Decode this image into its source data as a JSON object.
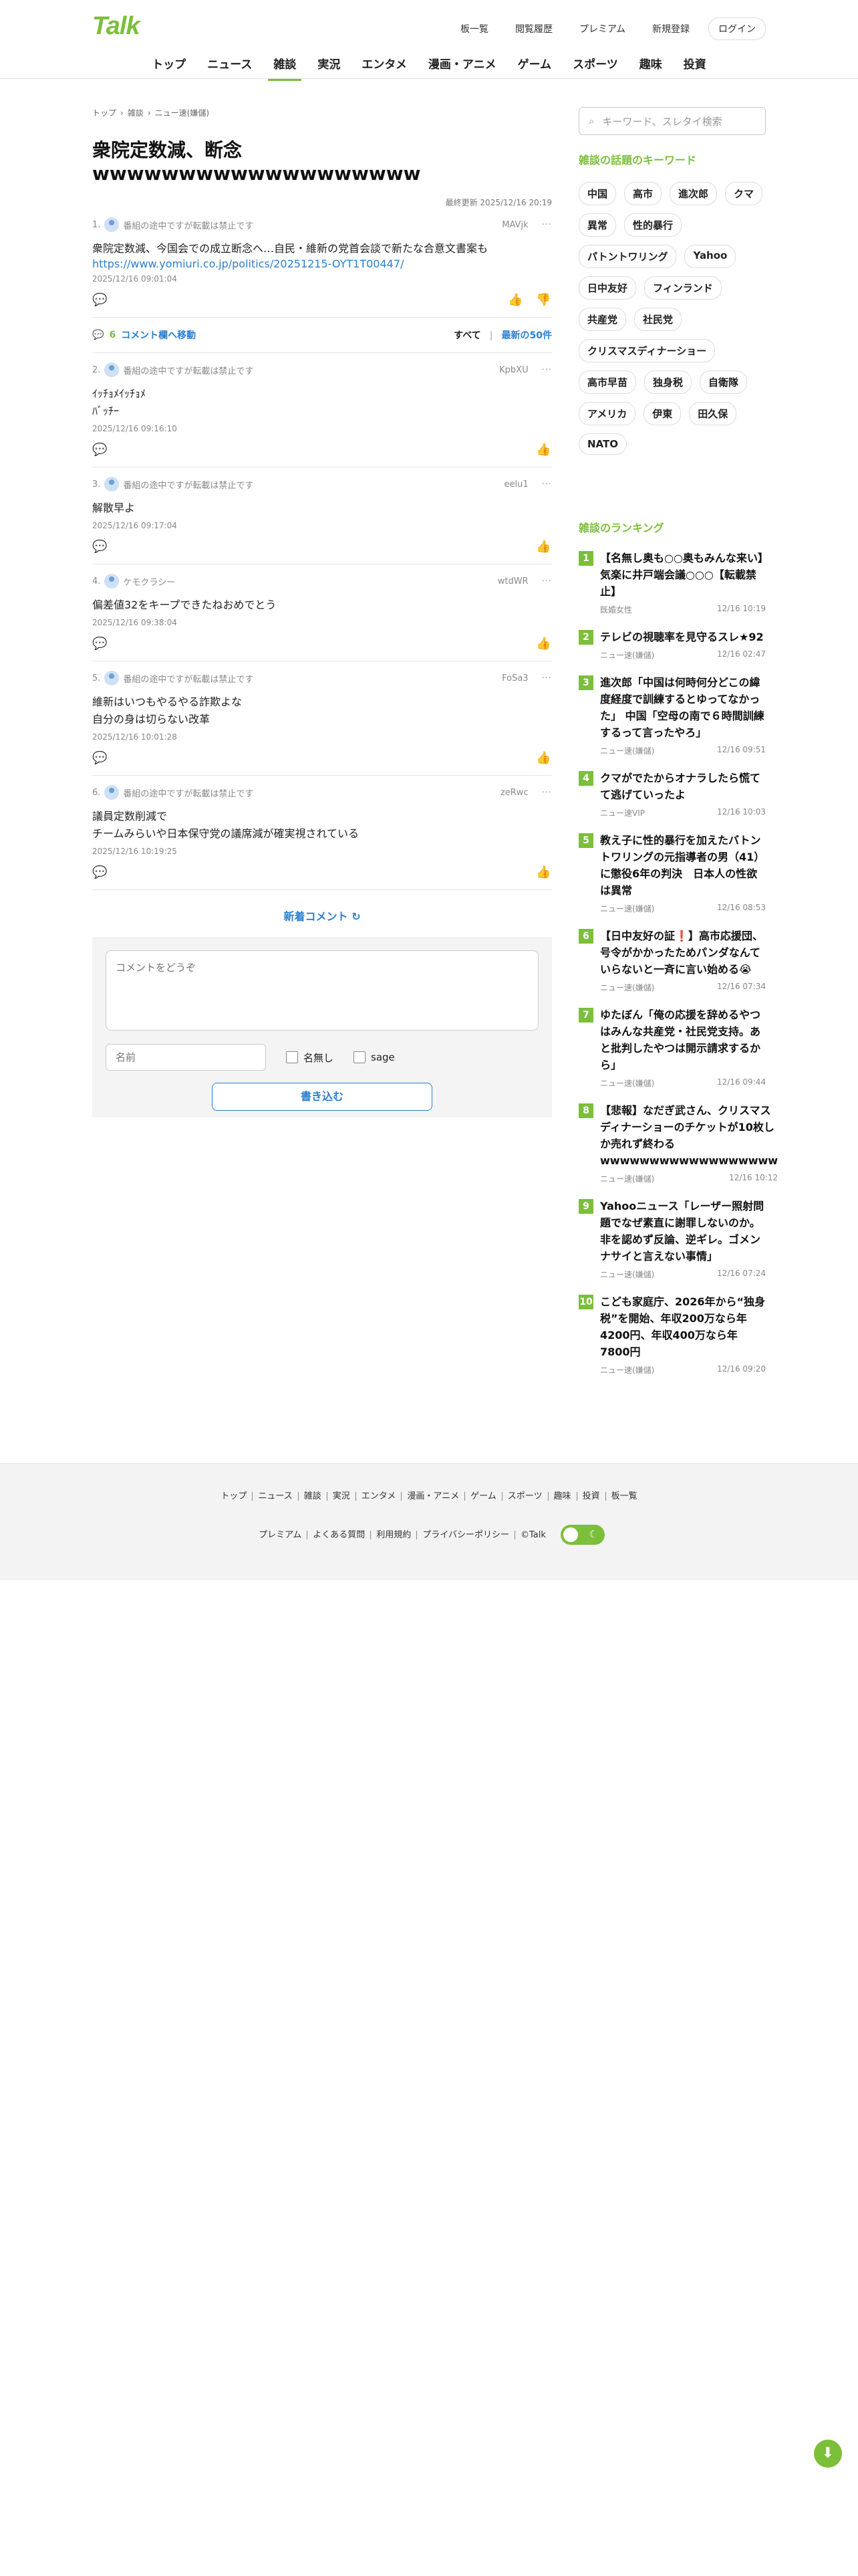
{
  "site": {
    "logo": "Talk"
  },
  "toplinks": [
    "板一覧",
    "閲覧履歴",
    "プレミアム",
    "新規登録",
    "ログイン"
  ],
  "nav": [
    "トップ",
    "ニュース",
    "雑談",
    "実況",
    "エンタメ",
    "漫画・アニメ",
    "ゲーム",
    "スポーツ",
    "趣味",
    "投資"
  ],
  "breadcrumbs": [
    "トップ",
    "雑談",
    "ニュー速(嫌儲)"
  ],
  "thread": {
    "title": "衆院定数減、断念wwwwwwwwwwwwwwwwwww",
    "updated": "最終更新 2025/12/16 20:19"
  },
  "posts": [
    {
      "num": "1.",
      "name": "番組の途中ですが転載は禁止です",
      "id": "MAVjk",
      "body": "衆院定数減、今国会での成立断念へ…自民・維新の党首会談で新たな合意文書案も",
      "link": "https://www.yomiuri.co.jp/politics/20251215-OYT1T00447/",
      "date": "2025/12/16 09:01:04"
    },
    {
      "num": "2.",
      "name": "番組の途中ですが転載は禁止です",
      "id": "KpbXU",
      "body": "ｲｯﾁｮﾒｲｯﾁｮﾒ\nﾊﾞｯﾁｰ",
      "link": "",
      "date": "2025/12/16 09:16:10"
    },
    {
      "num": "3.",
      "name": "番組の途中ですが転載は禁止です",
      "id": "eelu1",
      "body": "解散早よ",
      "link": "",
      "date": "2025/12/16 09:17:04"
    },
    {
      "num": "4.",
      "name": "ケモクラシー",
      "id": "wtdWR",
      "body": "偏差値32をキープできたねおめでとう",
      "link": "",
      "date": "2025/12/16 09:38:04"
    },
    {
      "num": "5.",
      "name": "番組の途中ですが転載は禁止です",
      "id": "FoSa3",
      "body": "維新はいつもやるやる詐欺よな\n自分の身は切らない改革",
      "link": "",
      "date": "2025/12/16 10:01:28"
    },
    {
      "num": "6.",
      "name": "番組の途中ですが転載は禁止です",
      "id": "zeRwc",
      "body": "議員定数削減で\nチームみらいや日本保守党の議席減が確実視されている",
      "link": "",
      "date": "2025/12/16 10:19:25"
    }
  ],
  "commentbar": {
    "count": "6",
    "jump": "コメント欄へ移動",
    "all": "すべて",
    "latest": "最新の50件"
  },
  "newcomment": "新着コメント",
  "form": {
    "placeholder": "コメントをどうぞ",
    "name_placeholder": "名前",
    "nanashi": "名無し",
    "sage": "sage",
    "submit": "書き込む"
  },
  "sidebar": {
    "search_placeholder": "キーワード、スレタイ検索",
    "keywords_title": "雑談の話題のキーワード",
    "keywords": [
      "中国",
      "高市",
      "進次郎",
      "クマ",
      "異常",
      "性的暴行",
      "パトントワリング",
      "Yahoo",
      "日中友好",
      "フィンランド",
      "共産党",
      "社民党",
      "クリスマスディナーショー",
      "高市早苗",
      "独身税",
      "自衛隊",
      "アメリカ",
      "伊東",
      "田久保",
      "NATO"
    ],
    "ranking_title": "雑談のランキング",
    "ranking": [
      {
        "n": "1",
        "title": "【名無し奥も○○奥もみんな来い】気楽に井戸端会議○○○【転載禁止】",
        "cat": "既婚女性",
        "time": "12/16 10:19"
      },
      {
        "n": "2",
        "title": "テレビの視聴率を見守るスレ★92",
        "cat": "ニュー速(嫌儲)",
        "time": "12/16 02:47"
      },
      {
        "n": "3",
        "title": "進次郎「中国は何時何分どこの緯度経度で訓練するとゆってなかった」 中国「空母の南で６時間訓練するって言ったやろ」",
        "cat": "ニュー速(嫌儲)",
        "time": "12/16 09:51"
      },
      {
        "n": "4",
        "title": "クマがでたからオナラしたら慌てて逃げていったよ",
        "cat": "ニュー速VIP",
        "time": "12/16 10:03"
      },
      {
        "n": "5",
        "title": "教え子に性的暴行を加えたバトントワリングの元指導者の男（41）に懲役6年の判決　日本人の性欲は異常",
        "cat": "ニュー速(嫌儲)",
        "time": "12/16 08:53"
      },
      {
        "n": "6",
        "title": "【日中友好の証❗】高市応援団、号令がかかったためパンダなんていらないと一斉に言い始める😭",
        "cat": "ニュー速(嫌儲)",
        "time": "12/16 07:34"
      },
      {
        "n": "7",
        "title": "ゆたぼん「俺の応援を辞めるやつはみんな共産党・社民党支持。あと批判したやつは開示請求するから」",
        "cat": "ニュー速(嫌儲)",
        "time": "12/16 09:44"
      },
      {
        "n": "8",
        "title": "【悲報】なだぎ武さん、クリスマスディナーショーのチケットが10枚しか売れず終わるwwwwwwwwwwwwwwwwww",
        "cat": "ニュー速(嫌儲)",
        "time": "12/16 10:12"
      },
      {
        "n": "9",
        "title": "Yahooニュース「レーザー照射問題でなぜ素直に謝罪しないのか。非を認めず反論、逆ギレ。ゴメンナサイと言えない事情」",
        "cat": "ニュー速(嫌儲)",
        "time": "12/16 07:24"
      },
      {
        "n": "10",
        "title": "こども家庭庁、2026年から“独身税”を開始、年収200万なら年4200円、年収400万なら年7800円",
        "cat": "ニュー速(嫌儲)",
        "time": "12/16 09:20"
      }
    ]
  },
  "footer": {
    "links1": [
      "トップ",
      "ニュース",
      "雑談",
      "実況",
      "エンタメ",
      "漫画・アニメ",
      "ゲーム",
      "スポーツ",
      "趣味",
      "投資",
      "板一覧"
    ],
    "links2": [
      "プレミアム",
      "よくある質問",
      "利用規約",
      "プライバシーポリシー",
      "©Talk"
    ]
  },
  "colors": {
    "brand": "#7bbf3a",
    "link": "#2a7fd0"
  },
  "icons": {
    "comment": "comment-icon",
    "like": "thumb-up-icon",
    "dislike": "thumb-down-icon",
    "scroll": "arrow-down-icon"
  }
}
